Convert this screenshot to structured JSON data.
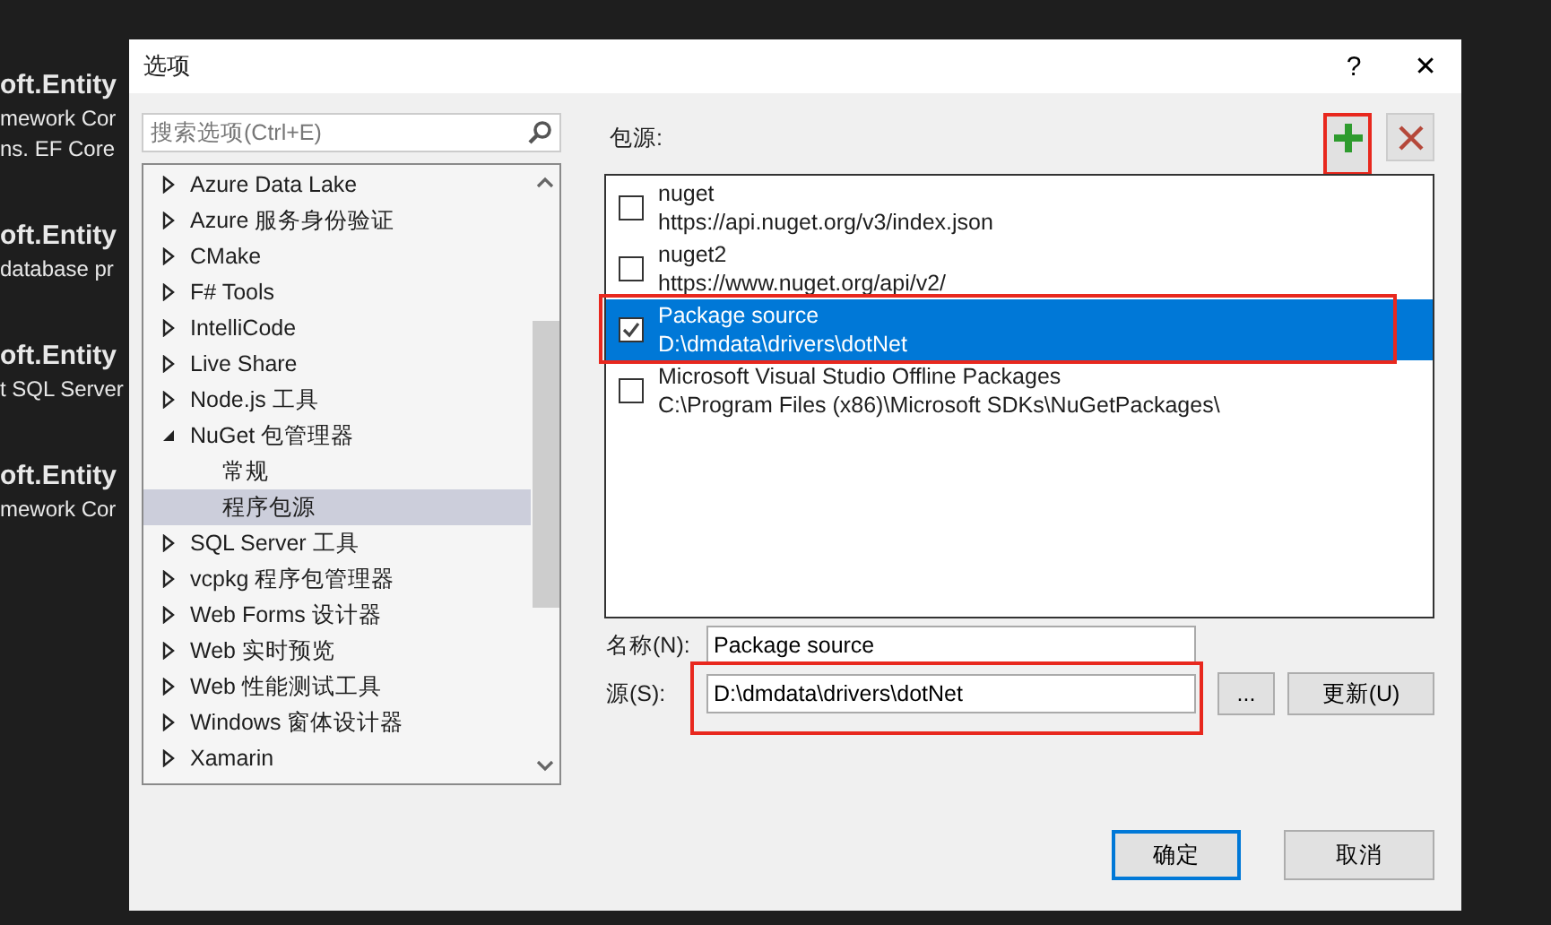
{
  "background": {
    "lines": [
      {
        "text": "oft.Entity",
        "kind": "title"
      },
      {
        "text": "mework Cor",
        "kind": "text"
      },
      {
        "text": "ns. EF Core",
        "kind": "text"
      },
      {
        "text": "oft.Entity",
        "kind": "title"
      },
      {
        "text": "database pr",
        "kind": "text"
      },
      {
        "text": "oft.Entity",
        "kind": "title"
      },
      {
        "text": "t SQL Server",
        "kind": "text"
      },
      {
        "text": "oft.Entity",
        "kind": "title"
      },
      {
        "text": "mework Cor",
        "kind": "text"
      }
    ]
  },
  "window": {
    "title": "选项",
    "help": "?",
    "close": "✕"
  },
  "search": {
    "placeholder": "搜索选项(Ctrl+E)"
  },
  "tree": {
    "items": [
      {
        "label": "Azure Data Lake",
        "expanded": false,
        "selected": false
      },
      {
        "label": "Azure 服务身份验证",
        "expanded": false,
        "selected": false
      },
      {
        "label": "CMake",
        "expanded": false,
        "selected": false
      },
      {
        "label": "F# Tools",
        "expanded": false,
        "selected": false
      },
      {
        "label": "IntelliCode",
        "expanded": false,
        "selected": false
      },
      {
        "label": "Live Share",
        "expanded": false,
        "selected": false
      },
      {
        "label": "Node.js 工具",
        "expanded": false,
        "selected": false
      },
      {
        "label": "NuGet 包管理器",
        "expanded": true,
        "selected": false,
        "children": [
          {
            "label": "常规",
            "selected": false
          },
          {
            "label": "程序包源",
            "selected": true
          }
        ]
      },
      {
        "label": "SQL Server 工具",
        "expanded": false,
        "selected": false
      },
      {
        "label": "vcpkg 程序包管理器",
        "expanded": false,
        "selected": false
      },
      {
        "label": "Web Forms 设计器",
        "expanded": false,
        "selected": false
      },
      {
        "label": "Web 实时预览",
        "expanded": false,
        "selected": false
      },
      {
        "label": "Web 性能测试工具",
        "expanded": false,
        "selected": false
      },
      {
        "label": "Windows 窗体设计器",
        "expanded": false,
        "selected": false
      },
      {
        "label": "Xamarin",
        "expanded": false,
        "selected": false
      }
    ]
  },
  "sources": {
    "label": "包源:",
    "items": [
      {
        "name": "nuget",
        "url": "https://api.nuget.org/v3/index.json",
        "checked": false,
        "selected": false
      },
      {
        "name": "nuget2",
        "url": "https://www.nuget.org/api/v2/",
        "checked": false,
        "selected": false
      },
      {
        "name": "Package source",
        "url": "D:\\dmdata\\drivers\\dotNet",
        "checked": true,
        "selected": true
      },
      {
        "name": "Microsoft Visual Studio Offline Packages",
        "url": "C:\\Program Files (x86)\\Microsoft SDKs\\NuGetPackages\\",
        "checked": false,
        "selected": false
      }
    ]
  },
  "name_field": {
    "label": "名称(N):",
    "value": "Package source"
  },
  "source_field": {
    "label": "源(S):",
    "value": "D:\\dmdata\\drivers\\dotNet"
  },
  "browse_button": "...",
  "update_button": {
    "label": "更新(U)"
  },
  "buttons": [
    {
      "label": "确定",
      "default": true
    },
    {
      "label": "取消",
      "default": false
    }
  ]
}
